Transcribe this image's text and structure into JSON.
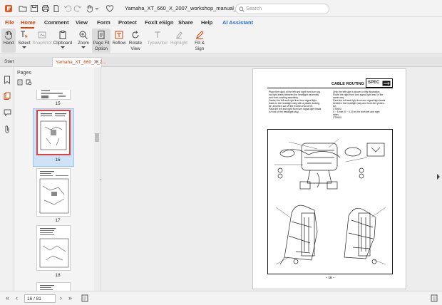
{
  "window": {
    "title": "Yamaha_XT_660_X_2007_workshop_manual_www.manualederep..."
  },
  "search": {
    "placeholder": "Search"
  },
  "menu": [
    {
      "label": "File"
    },
    {
      "label": "Home"
    },
    {
      "label": "Comment"
    },
    {
      "label": "View"
    },
    {
      "label": "Form"
    },
    {
      "label": "Protect"
    },
    {
      "label": "Foxit eSign"
    },
    {
      "label": "Share"
    },
    {
      "label": "Help"
    },
    {
      "label": "AI Assistant"
    }
  ],
  "ribbon": {
    "hand": "Hand",
    "select": "Select",
    "snapshot": "SnapShot",
    "clipboard": "Clipboard",
    "zoom": "Zoom",
    "page_fit_1": "Page Fit",
    "page_fit_2": "Option",
    "reflow": "Reflow",
    "rotate_1": "Rotate",
    "rotate_2": "View",
    "typewriter": "Typewriter",
    "highlight": "Highlight",
    "fill_sign_1": "Fill &",
    "fill_sign_2": "Sign"
  },
  "tabs": {
    "start": "Start",
    "document": "Yamaha_XT_660_X_2..."
  },
  "pages_panel": {
    "title": "Pages",
    "thumbnails": [
      {
        "number": "15"
      },
      {
        "number": "16"
      },
      {
        "number": "17"
      },
      {
        "number": "18"
      }
    ]
  },
  "document_page": {
    "header": "CABLE ROUTING",
    "badge": "SPEC",
    "left_col": [
      "Place the slack of the left and right front turn sig-",
      "nal light leads between the headlight assembly",
      "and front cowling assembly.",
      "Fasten the left and right front turn signal light",
      "leads to the headlight stay with a plastic locking",
      "tie, and then cut off the excess end of tie.",
      "Pass the left and right front turn signal light leads",
      "in front of the headlight stay."
    ],
    "right_col": [
      "Only the left side is shown in this illustration.",
      "Route the right front turn signal light lead in the",
      "same way.",
      "Pass the left and right front turn signal light leads",
      "between the headlight stay and front fork protec-",
      "tor.",
      "XT660X",
      "0 ~ 5 mm (0 ~ 0.20 in) for both left and right",
      "sides",
      "XT660X"
    ],
    "footer": "– 16 –"
  },
  "status": {
    "page_field": "16 / 81"
  }
}
